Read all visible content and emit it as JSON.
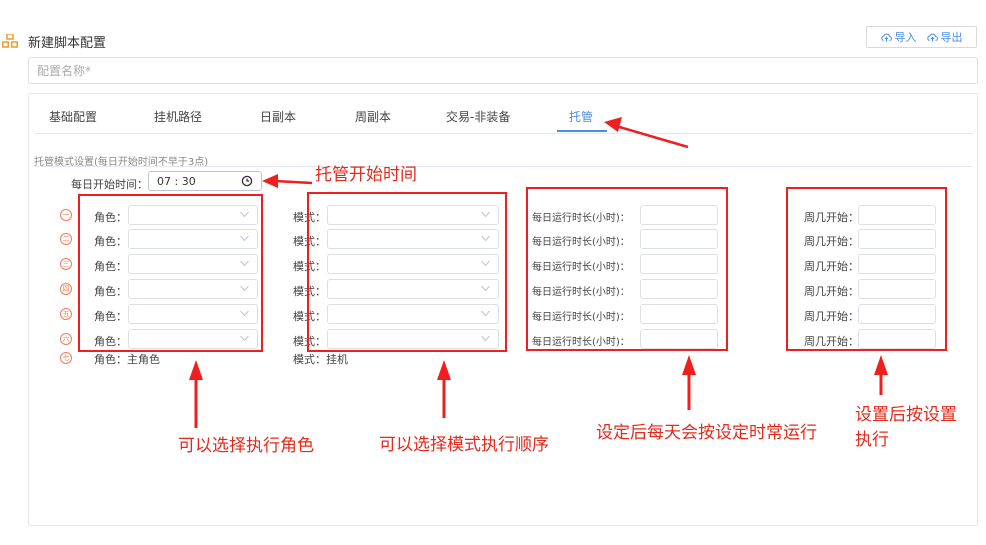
{
  "header": {
    "title": "新建脚本配置",
    "import_label": "导入",
    "export_label": "导出"
  },
  "name_input": {
    "placeholder": "配置名称*"
  },
  "tabs": [
    {
      "label": "基础配置"
    },
    {
      "label": "挂机路径"
    },
    {
      "label": "日副本"
    },
    {
      "label": "周副本"
    },
    {
      "label": "交易-非装备"
    },
    {
      "label": "托管"
    }
  ],
  "active_tab": "托管",
  "section": {
    "label": "托管模式设置(每日开始时间不早于3点)"
  },
  "start_time": {
    "label": "每日开始时间：",
    "value": "07 : 30"
  },
  "rows": [
    {
      "icon": "一",
      "role_label": "角色：",
      "mode_label": "模式：",
      "duration_label": "每日运行时长(小时)：",
      "week_label": "周几开始："
    },
    {
      "icon": "二",
      "role_label": "角色：",
      "mode_label": "模式：",
      "duration_label": "每日运行时长(小时)：",
      "week_label": "周几开始："
    },
    {
      "icon": "三",
      "role_label": "角色：",
      "mode_label": "模式：",
      "duration_label": "每日运行时长(小时)：",
      "week_label": "周几开始："
    },
    {
      "icon": "四",
      "role_label": "角色：",
      "mode_label": "模式：",
      "duration_label": "每日运行时长(小时)：",
      "week_label": "周几开始："
    },
    {
      "icon": "五",
      "role_label": "角色：",
      "mode_label": "模式：",
      "duration_label": "每日运行时长(小时)：",
      "week_label": "周几开始："
    },
    {
      "icon": "六",
      "role_label": "角色：",
      "mode_label": "模式：",
      "duration_label": "每日运行时长(小时)：",
      "week_label": "周几开始："
    }
  ],
  "row7": {
    "icon": "七",
    "role_text": "角色：主角色",
    "mode_text": "模式：挂机"
  },
  "annotations": {
    "start_time": "托管开始时间",
    "role": "可以选择执行角色",
    "mode": "可以选择模式执行顺序",
    "duration": "设定后每天会按设定时常运行",
    "week_line1": "设置后按设置",
    "week_line2": "执行"
  },
  "colors": {
    "accent": "#4a8de6",
    "annotation": "#e5291b",
    "row_icon": "#f07b5a",
    "header_icon": "#e9a43a"
  }
}
